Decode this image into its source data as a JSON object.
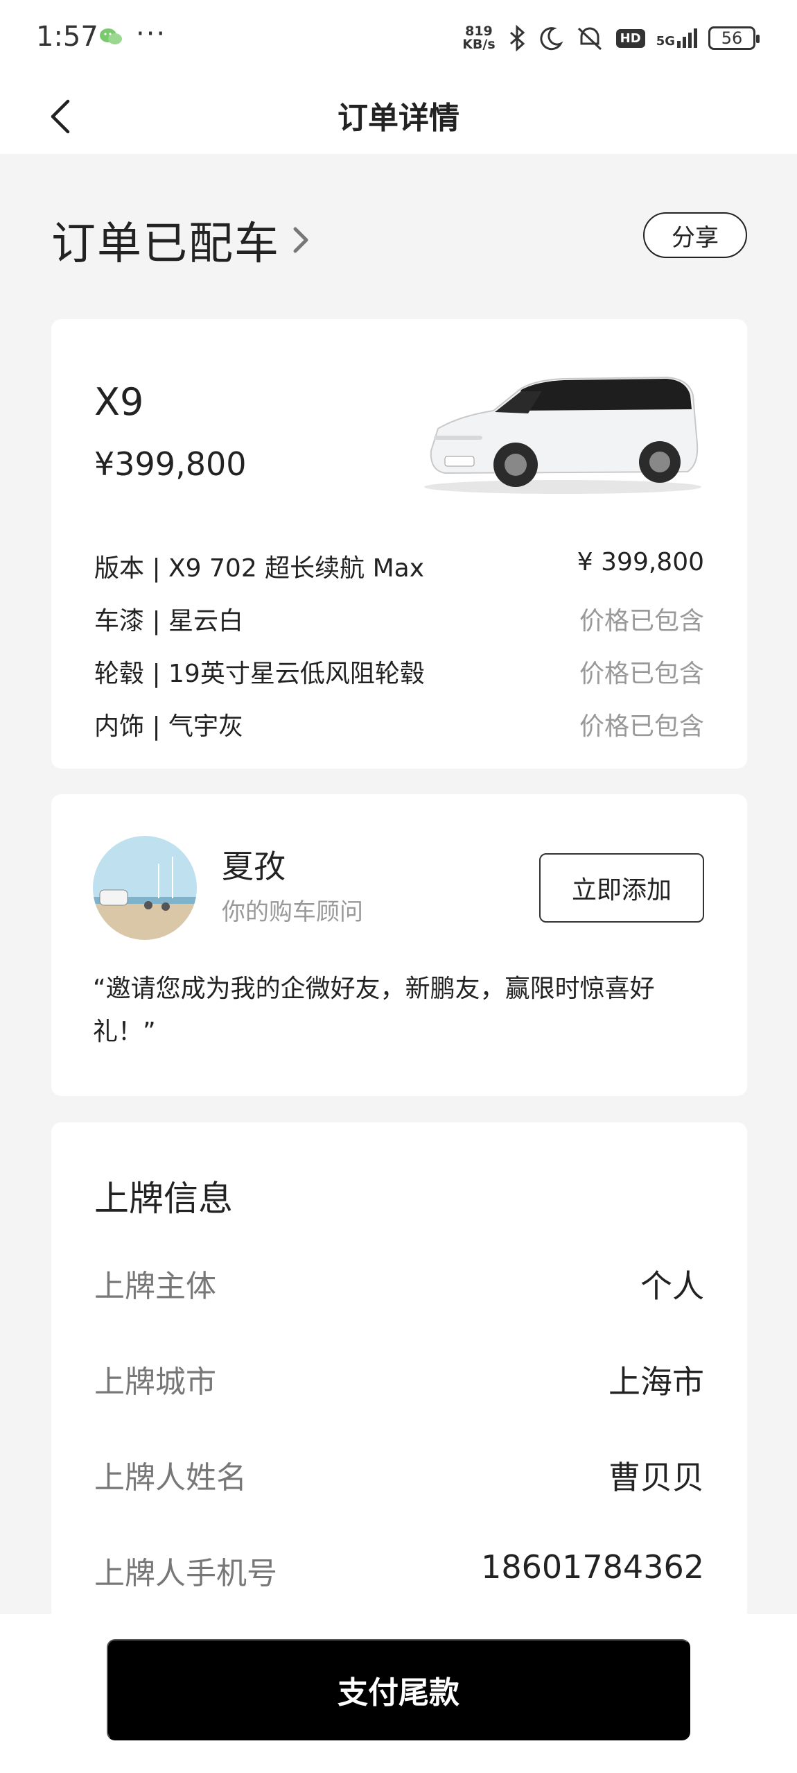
{
  "status_bar": {
    "time": "1:57",
    "dots": "···",
    "net_speed_top": "819",
    "net_speed_bottom": "KB/s",
    "hd": "HD",
    "network": "5G",
    "battery": "56"
  },
  "nav": {
    "title": "订单详情"
  },
  "order_status": {
    "title": "订单已配车",
    "share_label": "分享"
  },
  "car": {
    "model": "X9",
    "price": "¥399,800",
    "specs": [
      {
        "label": "版本 | X9 702 超长续航 Max",
        "value": "¥ 399,800",
        "muted": false
      },
      {
        "label": "车漆 | 星云白",
        "value": "价格已包含",
        "muted": true
      },
      {
        "label": "轮毂 | 19英寸星云低风阻轮毂",
        "value": "价格已包含",
        "muted": true
      },
      {
        "label": "内饰 | 气宇灰",
        "value": "价格已包含",
        "muted": true
      }
    ]
  },
  "advisor": {
    "name": "夏孜",
    "role": "你的购车顾问",
    "add_label": "立即添加",
    "quote": "“邀请您成为我的企微好友，新鹏友，赢限时惊喜好礼！”"
  },
  "plate": {
    "title": "上牌信息",
    "rows": [
      {
        "label": "上牌主体",
        "value": "个人"
      },
      {
        "label": "上牌城市",
        "value": "上海市"
      },
      {
        "label": "上牌人姓名",
        "value": "曹贝贝"
      },
      {
        "label": "上牌人手机号",
        "value": "18601784362"
      }
    ]
  },
  "footer": {
    "pay_label": "支付尾款"
  },
  "colors": {
    "page_bg": "#f4f4f4",
    "card_bg": "#ffffff",
    "primary_button": "#000000",
    "muted_text": "#999999",
    "label_text": "#777777"
  }
}
